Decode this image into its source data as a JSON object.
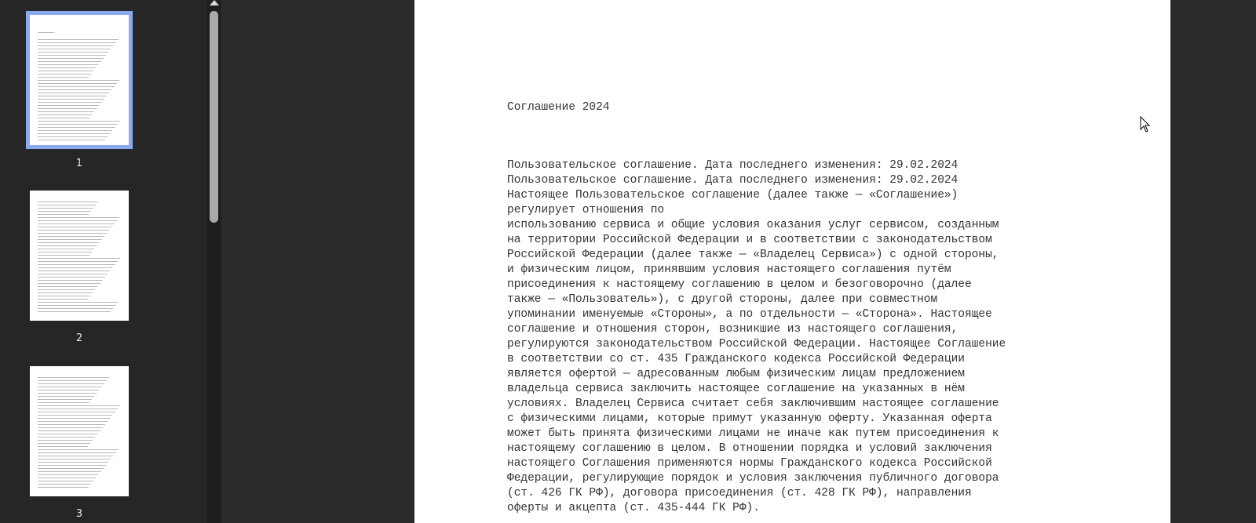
{
  "sidebar": {
    "pages": [
      {
        "number": "1",
        "selected": true
      },
      {
        "number": "2",
        "selected": false
      },
      {
        "number": "3",
        "selected": false
      }
    ]
  },
  "document": {
    "title": "Соглашение 2024",
    "lines": [
      "Пользовательское соглашение. Дата последнего изменения: 29.02.2024",
      "Пользовательское соглашение. Дата последнего изменения: 29.02.2024",
      "Настоящее Пользовательское соглашение (далее также — «Соглашение»)",
      "регулирует отношения по",
      "использованию сервиса и общие условия оказания услуг сервисом, созданным",
      "на территории Российской Федерации и в соответствии с законодательством",
      "Российской Федерации (далее также — «Владелец Сервиса») с одной стороны,",
      "и физическим лицом, принявшим условия настоящего соглашения путём",
      "присоединения к настоящему соглашению в целом и безоговорочно (далее",
      "также — «Пользователь»), с другой стороны, далее при совместном",
      "упоминании именуемые «Стороны», а по отдельности — «Сторона». Настоящее",
      "соглашение и отношения сторон, возникшие из настоящего соглашения,",
      "регулируются законодательством Российской Федерации. Настоящее Соглашение",
      "в соответствии со ст. 435 Гражданского кодекса Российской Федерации",
      "является офертой — адресованным любым физическим лицам предложением",
      "владельца сервиса заключить настоящее соглашение на указанных в нём",
      "условиях. Владелец Сервиса считает себя заключившим настоящее соглашение",
      "с физическими лицами, которые примут указанную оферту. Указанная оферта",
      "может быть принята физическими лицами не иначе как путем присоединения к",
      "настоящему соглашению в целом. В отношении порядка и условий заключения",
      "настоящего Соглашения применяются нормы Гражданского кодекса Российской",
      "Федерации, регулирующие порядок и условия заключения публичного договора",
      "(ст. 426 ГК РФ), договора присоединения (ст. 428 ГК РФ), направления",
      "оферты и акцепта (ст. 435-444 ГК РФ)."
    ]
  },
  "icons": {
    "cursor": "mouse-pointer-icon",
    "scroll_up": "arrow-up-icon"
  },
  "colors": {
    "selected_outline": "#8aaaf0",
    "background": "#2b2b2b",
    "page": "#ffffff",
    "text": "#333333"
  }
}
